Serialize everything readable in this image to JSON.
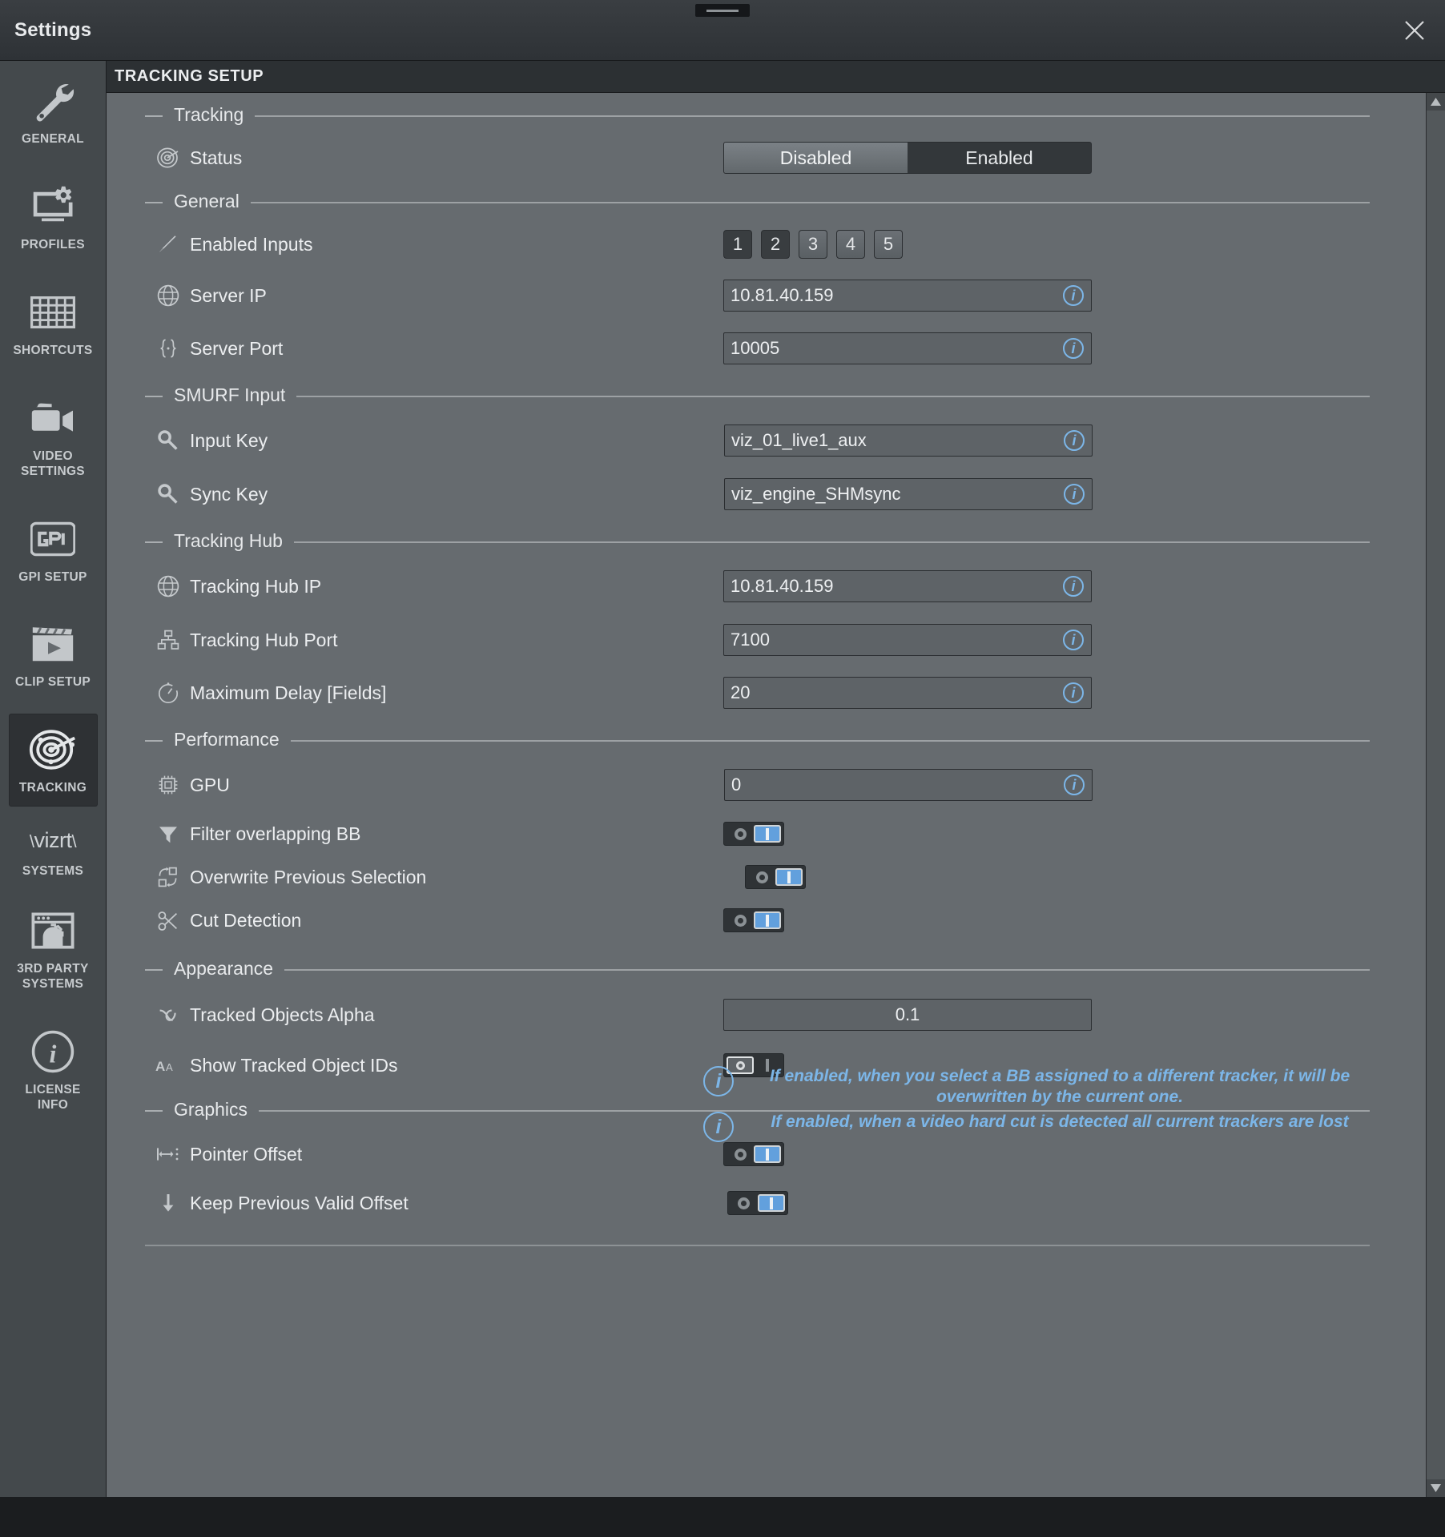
{
  "window": {
    "title": "Settings",
    "close_label": "×"
  },
  "sidebar": {
    "items": [
      {
        "label": "GENERAL",
        "icon": "wrench-icon",
        "active": false
      },
      {
        "label": "PROFILES",
        "icon": "monitor-gear-icon",
        "active": false
      },
      {
        "label": "SHORTCUTS",
        "icon": "keyboard-icon",
        "active": false
      },
      {
        "label": "VIDEO\nSETTINGS",
        "icon": "video-camera-icon",
        "active": false
      },
      {
        "label": "GPI SETUP",
        "icon": "gpi-icon",
        "active": false
      },
      {
        "label": "CLIP SETUP",
        "icon": "clapperboard-icon",
        "active": false
      },
      {
        "label": "TRACKING",
        "icon": "radar-target-icon",
        "active": true
      },
      {
        "label": "3RD PARTY\nSYSTEMS",
        "icon": "browser-gear-icon",
        "active": false
      },
      {
        "label": "LICENSE\nINFO",
        "icon": "info-circle-icon",
        "active": false
      }
    ],
    "brand": {
      "logo": "vizrt",
      "sub": "SYSTEMS"
    }
  },
  "section": {
    "title": "TRACKING SETUP"
  },
  "groups": {
    "tracking": "Tracking",
    "general": "General",
    "smurf": "SMURF Input",
    "hub": "Tracking Hub",
    "performance": "Performance",
    "appearance": "Appearance",
    "graphics": "Graphics"
  },
  "rows": {
    "status": {
      "label": "Status",
      "icon": "radar-target-icon",
      "option_off": "Disabled",
      "option_on": "Enabled",
      "selected": "Disabled"
    },
    "inputs": {
      "label": "Enabled Inputs",
      "icon": "tag-icon",
      "options": [
        "1",
        "2",
        "3",
        "4",
        "5"
      ],
      "selected": [
        "1",
        "2"
      ]
    },
    "server_ip": {
      "label": "Server IP",
      "icon": "globe-icon",
      "value": "10.81.40.159"
    },
    "server_port": {
      "label": "Server Port",
      "icon": "braces-icon",
      "value": "10005"
    },
    "input_key": {
      "label": "Input Key",
      "icon": "key-icon",
      "value": "viz_01_live1_aux"
    },
    "sync_key": {
      "label": "Sync Key",
      "icon": "key-icon",
      "value": "viz_engine_SHMsync"
    },
    "hub_ip": {
      "label": "Tracking Hub IP",
      "icon": "globe-icon",
      "value": "10.81.40.159"
    },
    "hub_port": {
      "label": "Tracking Hub Port",
      "icon": "network-icon",
      "value": "7100"
    },
    "max_delay": {
      "label": "Maximum Delay [Fields]",
      "icon": "stopwatch-icon",
      "value": "20"
    },
    "gpu": {
      "label": "GPU",
      "icon": "chip-icon",
      "value": "0"
    },
    "filter_bb": {
      "label": "Filter overlapping BB",
      "icon": "funnel-icon",
      "state": "on"
    },
    "overwrite": {
      "label": "Overwrite Previous Selection",
      "icon": "swap-boxes-icon",
      "state": "on"
    },
    "cut_detect": {
      "label": "Cut Detection",
      "icon": "scissors-icon",
      "state": "on"
    },
    "alpha": {
      "label": "Tracked Objects Alpha",
      "icon": "alpha-icon",
      "value": "0.1"
    },
    "show_ids": {
      "label": "Show Tracked Object IDs",
      "icon": "text-aa-icon",
      "state": "off"
    },
    "pointer_off": {
      "label": "Pointer Offset",
      "icon": "offset-icon",
      "state": "on"
    },
    "keep_offset": {
      "label": "Keep Previous Valid Offset",
      "icon": "arrow-down-icon",
      "state": "on"
    }
  },
  "hints": {
    "overwrite": "If enabled, when you select a BB assigned to a different tracker, it will be overwritten by the current one.",
    "cut_detection": "If enabled, when a video hard cut is detected all current trackers are lost",
    "icon_label": "i"
  },
  "colors": {
    "accent_blue": "#7cb6e8",
    "toggle_on": "#62a0dd",
    "panel_bg": "#666b6f",
    "sidebar_bg": "#44494c"
  }
}
